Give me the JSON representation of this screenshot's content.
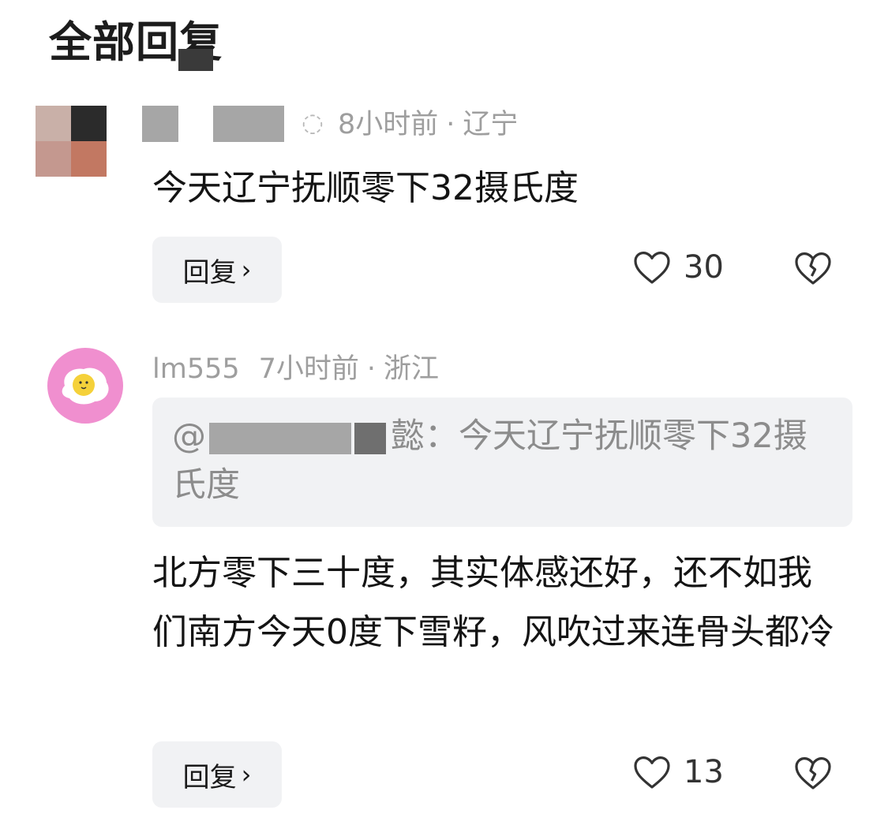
{
  "section": {
    "title": "全部回复"
  },
  "comments": [
    {
      "time": "8小时前",
      "location": "辽宁",
      "text": "今天辽宁抚顺零下32摄氏度",
      "reply_label": "回复",
      "likes": "30"
    },
    {
      "username": "lm555",
      "time": "7小时前",
      "location": "浙江",
      "quote_name_suffix": "懿：",
      "quote_text": "今天辽宁抚顺零下32摄氏度",
      "text": "北方零下三十度，其实体感还好，还不如我们南方今天0度下雪籽，风吹过来连骨头都冷",
      "reply_label": "回复",
      "likes": "13"
    }
  ],
  "icons": {
    "heart": "heart-outline-icon",
    "dislike": "broken-heart-icon",
    "chevron": "chevron-right-icon"
  },
  "colors": {
    "meta": "#9e9e9e",
    "button_bg": "#f1f2f4",
    "avatar_bg": "#f08fcf"
  }
}
